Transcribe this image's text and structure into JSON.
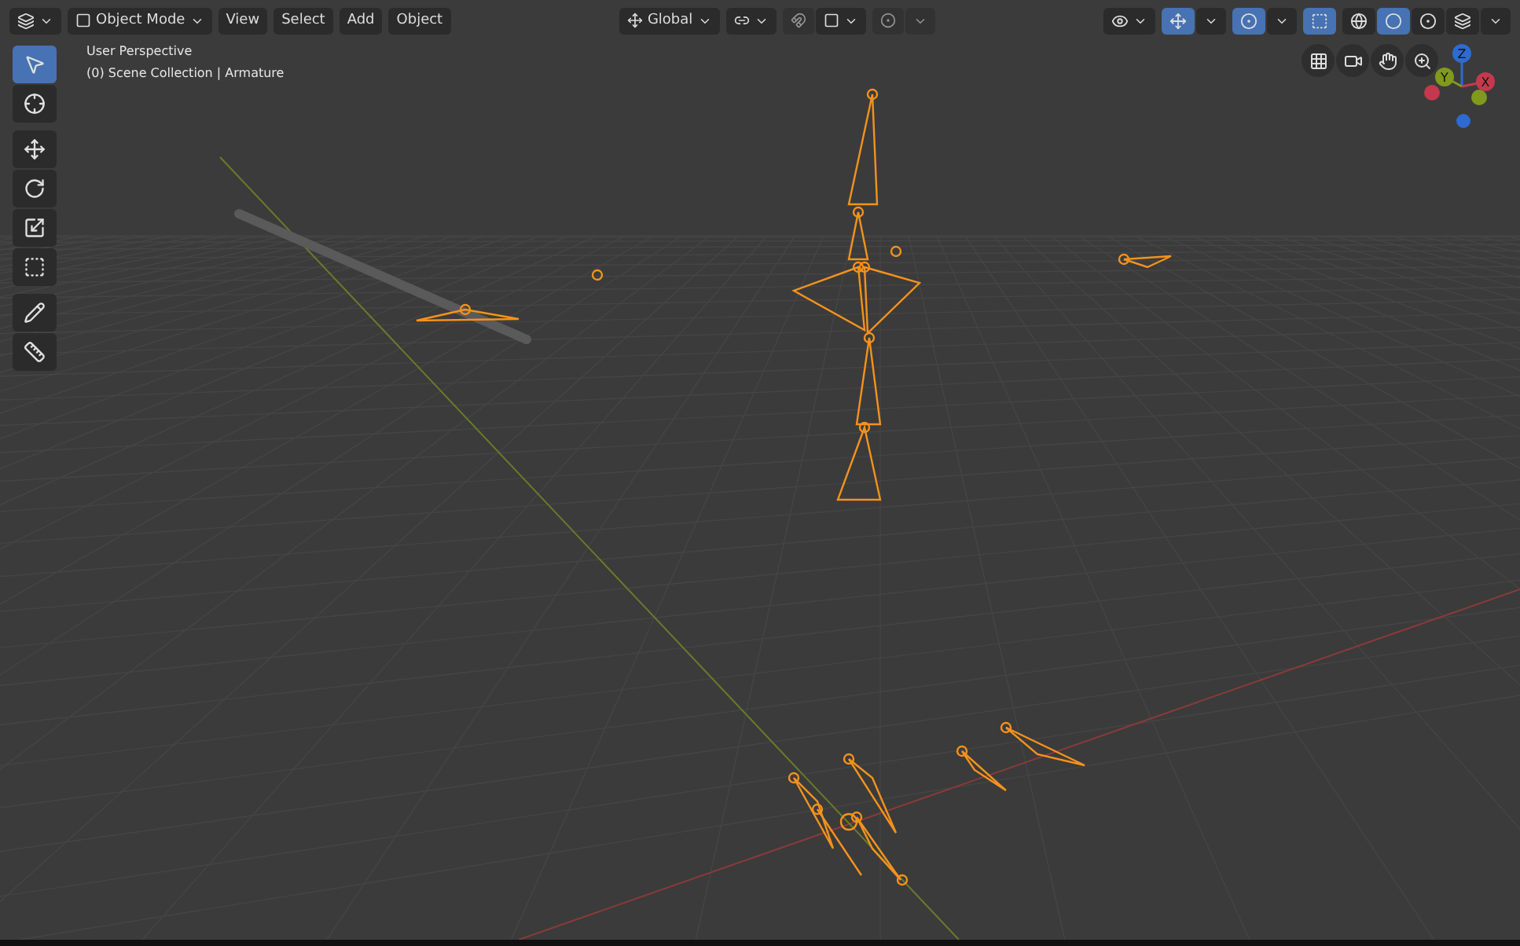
{
  "header": {
    "mode": "Object Mode",
    "menus": [
      "View",
      "Select",
      "Add",
      "Object"
    ],
    "orientation": "Global",
    "snap": {
      "on": false
    },
    "proportional": {
      "on": false
    },
    "gizmos": {
      "on": true
    },
    "overlays": {
      "on": true
    },
    "xray": {
      "on": true
    },
    "shading": [
      {
        "kind": "wireframe",
        "selected": false
      },
      {
        "kind": "solid",
        "selected": true
      },
      {
        "kind": "material",
        "selected": false
      },
      {
        "kind": "rendered",
        "selected": false
      }
    ]
  },
  "toolbar": {
    "groups": [
      [
        {
          "kind": "select",
          "selected": true
        },
        {
          "kind": "cursor",
          "selected": false
        }
      ],
      [
        {
          "kind": "move",
          "selected": false
        },
        {
          "kind": "rotate",
          "selected": false
        },
        {
          "kind": "scale",
          "selected": false
        },
        {
          "kind": "transform",
          "selected": false
        }
      ],
      [
        {
          "kind": "annotate",
          "selected": false
        },
        {
          "kind": "measure",
          "selected": false
        }
      ]
    ]
  },
  "viewport": {
    "info": [
      "User Perspective",
      "(0) Scene Collection | Armature"
    ],
    "axes": [
      {
        "label": "Z",
        "color": "#2e6ad0"
      },
      {
        "label": "Y",
        "color": "#7f9a1d"
      },
      {
        "label": "X",
        "color": "#c4394d"
      }
    ]
  }
}
